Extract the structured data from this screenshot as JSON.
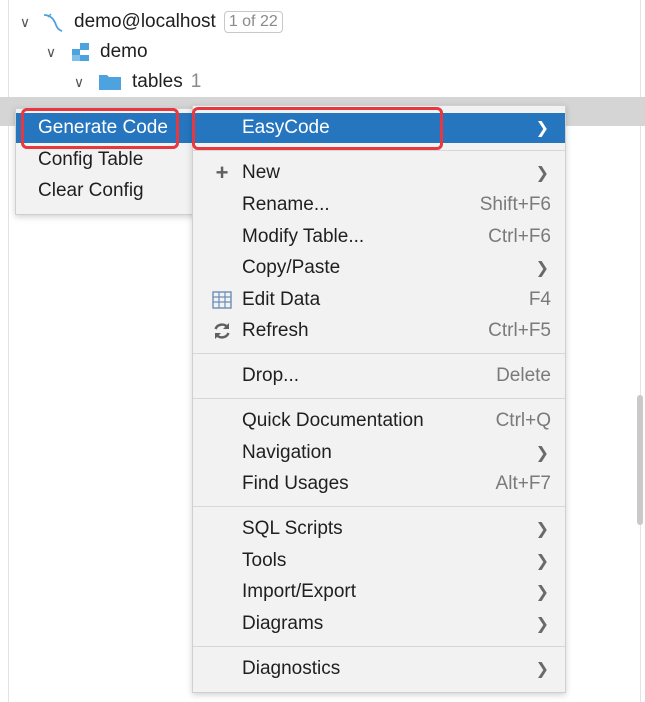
{
  "tree": {
    "connection_label": "demo@localhost",
    "connection_badge": "1 of 22",
    "schema_label": "demo",
    "tables_label": "tables",
    "tables_count": "1"
  },
  "left_menu": {
    "items": [
      "Generate Code",
      "Config Table",
      "Clear Config"
    ]
  },
  "context_menu": {
    "easycode": "EasyCode",
    "new": "New",
    "rename": "Rename...",
    "rename_sc": "Shift+F6",
    "modify_table": "Modify Table...",
    "modify_table_sc": "Ctrl+F6",
    "copy_paste": "Copy/Paste",
    "edit_data": "Edit Data",
    "edit_data_sc": "F4",
    "refresh": "Refresh",
    "refresh_sc": "Ctrl+F5",
    "drop": "Drop...",
    "drop_sc": "Delete",
    "quick_doc": "Quick Documentation",
    "quick_doc_sc": "Ctrl+Q",
    "navigation": "Navigation",
    "find_usages": "Find Usages",
    "find_usages_sc": "Alt+F7",
    "sql_scripts": "SQL Scripts",
    "tools": "Tools",
    "import_export": "Import/Export",
    "diagrams": "Diagrams",
    "diagnostics": "Diagnostics"
  },
  "colors": {
    "highlight": "#2675bf",
    "annotation": "#e5393f",
    "folder": "#4da3e0"
  }
}
